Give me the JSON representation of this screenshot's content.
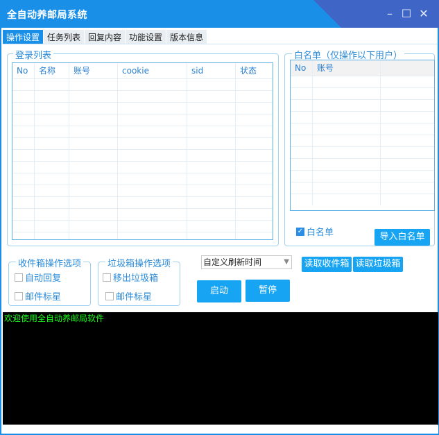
{
  "window": {
    "title": "全自动养邮局系统",
    "min_icon": "minimize-icon",
    "max_icon": "maximize-icon",
    "close_icon": "close-icon"
  },
  "tabs": [
    {
      "label": "操作设置",
      "active": true
    },
    {
      "label": "任务列表"
    },
    {
      "label": "回复内容"
    },
    {
      "label": "功能设置"
    },
    {
      "label": "版本信息"
    }
  ],
  "login_list": {
    "title": "登录列表",
    "columns": [
      "No",
      "名称",
      "账号",
      "cookie",
      "sid",
      "状态"
    ]
  },
  "whitelist": {
    "title": "白名单（仅操作以下用户）",
    "columns": [
      "No",
      "账号"
    ],
    "checkbox_label": "白名单",
    "checkbox_checked": true,
    "import_button": "导入白名单"
  },
  "inbox_options": {
    "title": "收件箱操作选项",
    "auto_reply": "自动回复",
    "mark_star": "邮件标星"
  },
  "trash_options": {
    "title": "垃圾箱操作选项",
    "move_out": "移出垃圾箱",
    "mark_star": "邮件标星"
  },
  "refresh_select": {
    "value": "自定义刷新时间"
  },
  "buttons": {
    "read_inbox": "读取收件箱",
    "read_trash": "读取垃圾箱",
    "start": "启动",
    "pause": "暂停"
  },
  "console": {
    "text": "欢迎使用全自动养邮局软件"
  },
  "colors": {
    "accent": "#1a8fe8",
    "button": "#16a4f3",
    "console_bg": "#000000",
    "console_text": "#19ff19"
  }
}
